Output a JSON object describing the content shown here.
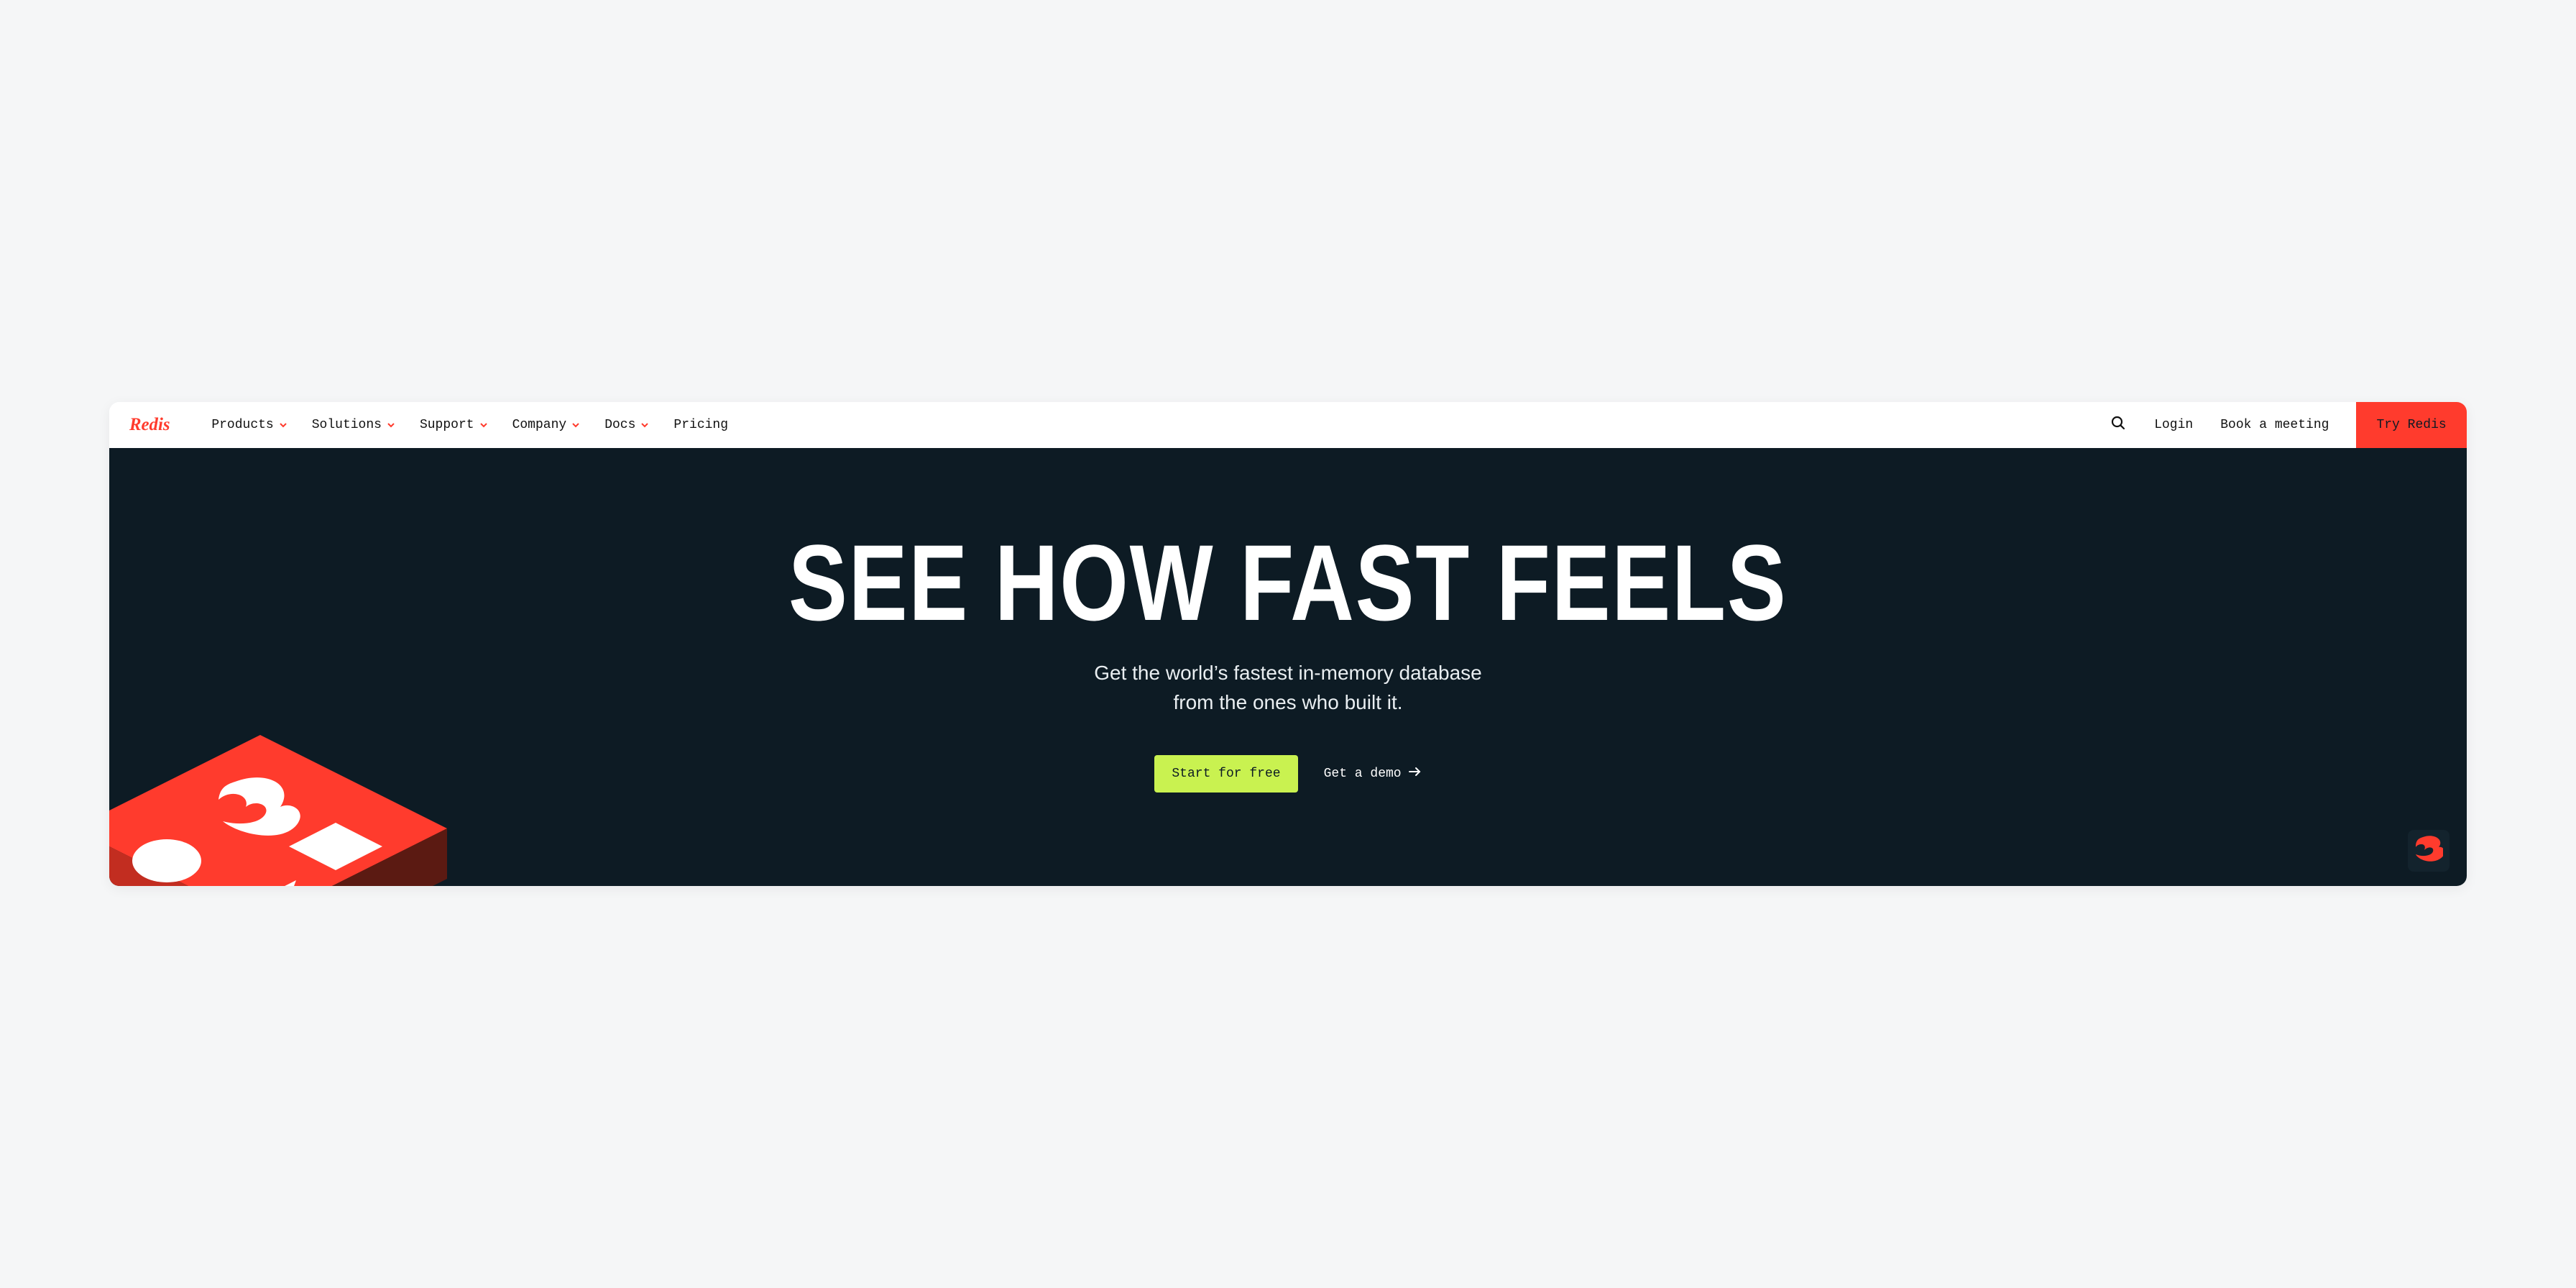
{
  "brand": {
    "name": "Redis"
  },
  "nav": {
    "items": [
      {
        "label": "Products",
        "hasDropdown": true
      },
      {
        "label": "Solutions",
        "hasDropdown": true
      },
      {
        "label": "Support",
        "hasDropdown": true
      },
      {
        "label": "Company",
        "hasDropdown": true
      },
      {
        "label": "Docs",
        "hasDropdown": true
      },
      {
        "label": "Pricing",
        "hasDropdown": false
      }
    ],
    "login": "Login",
    "book": "Book a meeting",
    "try": "Try Redis"
  },
  "hero": {
    "title": "SEE HOW FAST FEELS",
    "sub_line1": "Get the world’s fastest in-memory database",
    "sub_line2": "from the ones who built it.",
    "cta_primary": "Start for free",
    "cta_secondary": "Get a demo"
  },
  "colors": {
    "accent": "#ff3b2d",
    "hero_bg": "#0d1b24",
    "cta_bg": "#c9f250"
  }
}
